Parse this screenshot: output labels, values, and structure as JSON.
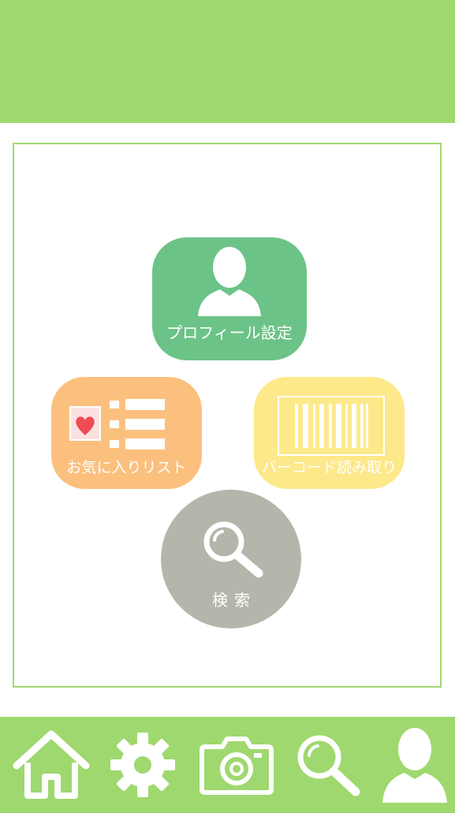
{
  "colors": {
    "header": "#9fd86f",
    "panel_border": "#9fd86f",
    "profile_tile": "#6cc387",
    "favorites_tile": "#fbc07e",
    "barcode_tile": "#fde98a",
    "search_tile": "#b3b7ab",
    "icon": "#ffffff"
  },
  "menu": {
    "profile": {
      "label": "プロフィール設定",
      "icon": "person-icon"
    },
    "favorites": {
      "label": "お気に入りリスト",
      "icon": "favorites-list-icon"
    },
    "barcode": {
      "label": "バーコード読み取り",
      "icon": "barcode-icon"
    },
    "search": {
      "label": "検索",
      "icon": "search-icon"
    }
  },
  "tabbar": {
    "items": [
      {
        "icon": "home-icon"
      },
      {
        "icon": "gear-icon"
      },
      {
        "icon": "camera-icon"
      },
      {
        "icon": "search-icon"
      },
      {
        "icon": "person-icon"
      }
    ]
  }
}
